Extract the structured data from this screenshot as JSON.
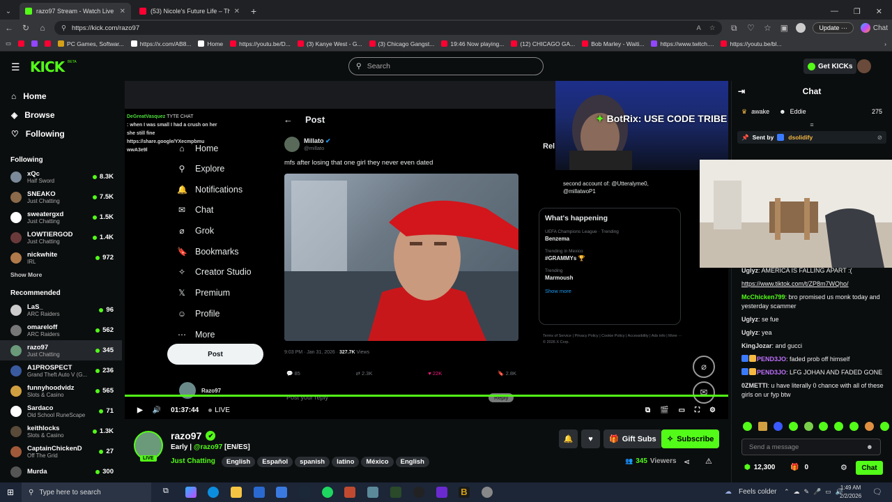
{
  "browser": {
    "tabs": [
      {
        "title": "razo97 Stream - Watch Live on Kick",
        "active": true,
        "color": "#53fc18"
      },
      {
        "title": "(53) Nicole's Future Life – The Wo",
        "active": false,
        "color": "#ff0033"
      }
    ],
    "new_tab": "+",
    "url": "https://kick.com/razo97",
    "update_label": "Update",
    "chat_label": "Chat",
    "bookmarks": [
      {
        "label": "PC Games, Softwar...",
        "color": "#d4a017"
      },
      {
        "label": "https://x.com/AB8...",
        "color": "#ffffff"
      },
      {
        "label": "Home",
        "color": "#ffffff"
      },
      {
        "label": "https://youtu.be/D...",
        "color": "#ff0033"
      },
      {
        "label": "(3) Kanye West - G...",
        "color": "#ff0033"
      },
      {
        "label": "(3) Chicago Gangst...",
        "color": "#ff0033"
      },
      {
        "label": "19:46 Now playing...",
        "color": "#ff0033"
      },
      {
        "label": "(12) CHICAGO GA...",
        "color": "#ff0033"
      },
      {
        "label": "Bob Marley - Waiti...",
        "color": "#ff0033"
      },
      {
        "label": "https://www.twitch....",
        "color": "#9146ff"
      },
      {
        "label": "https://youtu.be/bl...",
        "color": "#ff0033"
      }
    ]
  },
  "header": {
    "logo": "KICK",
    "logo_beta": "BETA",
    "search_placeholder": "Search",
    "get_kicks": "Get KICKs"
  },
  "sidebar": {
    "nav": [
      {
        "label": "Home",
        "icon": "home-icon"
      },
      {
        "label": "Browse",
        "icon": "compass-icon"
      },
      {
        "label": "Following",
        "icon": "heart-icon"
      }
    ],
    "following_title": "Following",
    "following": [
      {
        "name": "xQc",
        "category": "Half Sword",
        "viewers": "8.3K",
        "color": "#7a8a9a"
      },
      {
        "name": "SNEAKO",
        "category": "Just Chatting",
        "viewers": "7.5K",
        "color": "#8a6a4a"
      },
      {
        "name": "sweatergxd",
        "category": "Just Chatting",
        "viewers": "1.5K",
        "color": "#ffffff"
      },
      {
        "name": "LOWTIERGOD",
        "category": "Just Chatting",
        "viewers": "1.4K",
        "color": "#6a3a3a"
      },
      {
        "name": "nickwhite",
        "category": "IRL",
        "viewers": "972",
        "color": "#b07a4a"
      }
    ],
    "show_more_1": "Show More",
    "recommended_title": "Recommended",
    "recommended": [
      {
        "name": "LaS_",
        "category": "ARC Raiders",
        "viewers": "96",
        "color": "#cccccc"
      },
      {
        "name": "omareloff",
        "category": "ARC Raiders",
        "viewers": "562",
        "color": "#777777"
      },
      {
        "name": "razo97",
        "category": "Just Chatting",
        "viewers": "345",
        "color": "#6a9a7a",
        "selected": true
      },
      {
        "name": "A1PROSPECT",
        "category": "Grand Theft Auto V (G...",
        "viewers": "236",
        "color": "#3a5aa0"
      },
      {
        "name": "funnyhoodvidz",
        "category": "Slots & Casino",
        "viewers": "565",
        "color": "#d0a040"
      },
      {
        "name": "Sardaco",
        "category": "Old School RuneScape",
        "viewers": "71",
        "color": "#ffffff"
      },
      {
        "name": "keithlocks",
        "category": "Slots & Casino",
        "viewers": "1.3K",
        "color": "#5a4a3a"
      },
      {
        "name": "CaptainChickenD",
        "category": "Off The Grid",
        "viewers": "27",
        "color": "#a05a3a"
      },
      {
        "name": "Murda",
        "category": "",
        "viewers": "300",
        "color": "#555555"
      }
    ]
  },
  "video": {
    "tw": {
      "top_chat": "DeGreatVasquez",
      "top_chat_2": "TYTE CHAT",
      "chat_line": ": when I was small I had a crush on her she still fine https://share.google/YXecmpbmu wwA3e9l",
      "post_header": "Post",
      "nav": [
        "Home",
        "Explore",
        "Notifications",
        "Chat",
        "Grok",
        "Bookmarks",
        "Creator Studio",
        "Premium",
        "Profile",
        "More"
      ],
      "post_button": "Post",
      "author": "Millato",
      "handle": "@millato",
      "tweet_text": "mfs after losing that one girl they never even dated",
      "tweet_meta": "9:03 PM · Jan 31, 2026 · ",
      "views": "327.7K",
      "views_label": "Views",
      "stats": [
        "85",
        "2.3K",
        "22K",
        "2.8K"
      ],
      "reply_placeholder": "Post your reply",
      "reply_btn": "Reply",
      "profile_name": "Razo97",
      "second_account": "second account of: @Utteralyme0, @millatwoP1",
      "relevant": "Rel",
      "whats_happening": "What's happening",
      "trends": [
        {
          "context": "UEFA Champions League · Trending",
          "name": "Benzema"
        },
        {
          "context": "Trending in Mexico",
          "name": "#GRAMMYs 🏆"
        },
        {
          "context": "Trending",
          "name": "Marmoush"
        }
      ],
      "show_more": "Show more",
      "footer": "Terms of Service | Privacy Policy | Cookie Policy | Accessibility | Ads info | More ··· © 2026 X Corp."
    },
    "botrix": "BotRix: USE CODE TRIBE https://gamba.com?c=Tribe",
    "time": "01:37:44",
    "live": "LIVE"
  },
  "stream": {
    "name": "razo97",
    "title_prefix": "Early |",
    "mention": "@razo97",
    "title_suffix": "[EN/ES]",
    "category": "Just Chatting",
    "tags": [
      "English",
      "Español",
      "spanish",
      "latino",
      "México",
      "English"
    ],
    "live_badge": "LIVE",
    "gift_subs": "Gift Subs",
    "subscribe": "Subscribe",
    "viewers": "345",
    "viewers_label": "Viewers"
  },
  "chat": {
    "title": "Chat",
    "top_user": "awake",
    "top_user_2": "Eddie",
    "top_count": "275",
    "sent_by_label": "Sent by",
    "sent_by_user": "dsolidify",
    "messages": [
      {
        "user": "Uglyz",
        "text": "AMÉRICA IS FALLING APART :(",
        "color": "#e0e0e0"
      },
      {
        "user": "",
        "text": "https://www.tiktok.com/t/ZP8m7WQho/",
        "color": "#e0e0e0",
        "link": true
      },
      {
        "user": "McChicken799",
        "text": "bro promised us monk today and yesterday scammer",
        "color": "#53fc18"
      },
      {
        "user": "Uglyz",
        "text": "se fue",
        "color": "#e0e0e0"
      },
      {
        "user": "Uglyz",
        "text": "yea",
        "color": "#e0e0e0"
      },
      {
        "user": "KingJozar",
        "text": "and gucci",
        "color": "#e0e0e0"
      },
      {
        "user": "PEND3JO",
        "text": "faded prob off himself",
        "color": "#c070ff"
      },
      {
        "user": "PEND3JO",
        "text": "LFG JOHAN AND FADED GONE",
        "color": "#c070ff"
      },
      {
        "user": "0ZMETTI",
        "text": "u have literally 0 chance with all of these girls on ur fyp btw",
        "color": "#e0e0e0"
      }
    ],
    "send_placeholder": "Send a message",
    "kicks_balance": "12,300",
    "gift_count": "0",
    "chat_button": "Chat"
  },
  "taskbar": {
    "search_placeholder": "Type here to search",
    "weather": "Feels colder",
    "time": "1:49 AM",
    "date": "2/2/2026"
  },
  "colors": {
    "kick_green": "#53fc18",
    "bg": "#0b0e0f",
    "verified": "#53fc18"
  }
}
